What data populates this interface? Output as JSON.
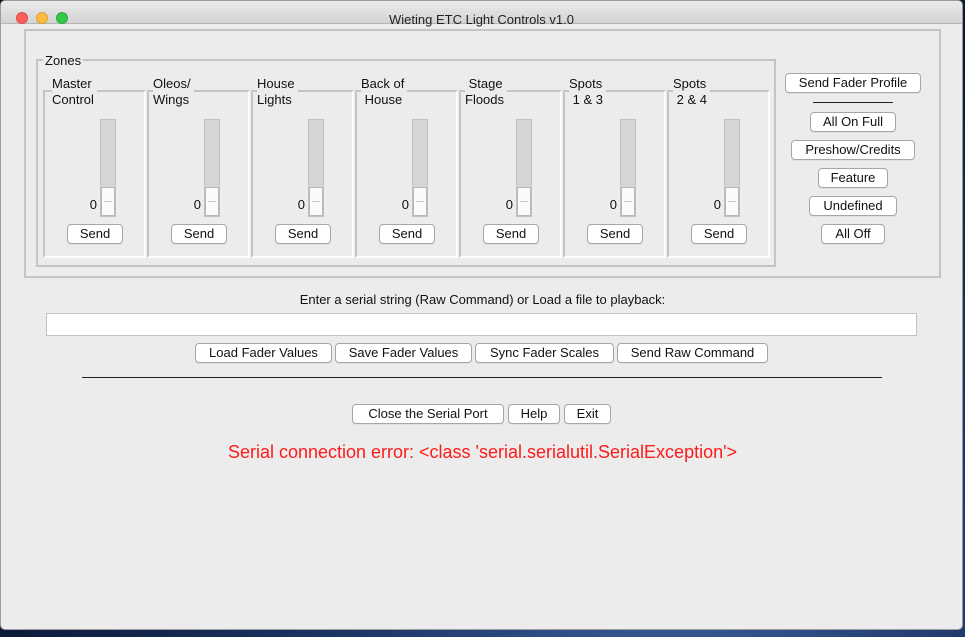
{
  "window": {
    "title": "Wieting ETC Light Controls v1.0"
  },
  "zones": {
    "title": "Zones",
    "send_label": "Send",
    "items": [
      {
        "label": "Master\nControl",
        "value": "0"
      },
      {
        "label": "Oleos/\nWings",
        "value": "0"
      },
      {
        "label": "House\nLights",
        "value": "0"
      },
      {
        "label": "Back of\n House",
        "value": "0"
      },
      {
        "label": " Stage\nFloods",
        "value": "0"
      },
      {
        "label": "Spots\n 1 & 3",
        "value": "0"
      },
      {
        "label": "Spots\n 2 & 4",
        "value": "0"
      }
    ]
  },
  "right_panel": {
    "send_fader_profile": "Send Fader Profile",
    "all_on_full": "All On Full",
    "preshow_credits": "Preshow/Credits",
    "feature": "Feature",
    "undefined": "Undefined",
    "all_off": "All Off"
  },
  "raw_command": {
    "label": "Enter a serial string (Raw Command) or Load a file to playback:",
    "value": "",
    "load_fader_values": "Load Fader Values",
    "save_fader_values": "Save Fader Values",
    "sync_fader_scales": "Sync Fader Scales",
    "send_raw_command": "Send Raw Command"
  },
  "bottom": {
    "close_serial_port": "Close the Serial Port",
    "help": "Help",
    "exit": "Exit",
    "error_message": "Serial connection error: <class 'serial.serialutil.SerialException'>"
  },
  "colors": {
    "error": "#ff1a1a"
  }
}
